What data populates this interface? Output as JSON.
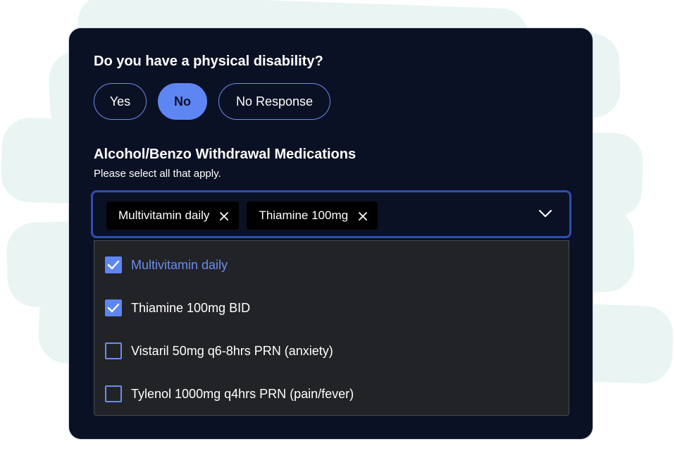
{
  "question": {
    "text": "Do you have a physical disability?",
    "options": [
      {
        "label": "Yes",
        "selected": false
      },
      {
        "label": "No",
        "selected": true
      },
      {
        "label": "No Response",
        "selected": false
      }
    ]
  },
  "medications": {
    "title": "Alcohol/Benzo Withdrawal Medications",
    "subtitle": "Please select all that apply.",
    "selected_chips": [
      {
        "label": "Multivitamin daily"
      },
      {
        "label": "Thiamine 100mg"
      }
    ],
    "dropdown_options": [
      {
        "label": "Multivitamin daily",
        "checked": true
      },
      {
        "label": "Thiamine 100mg BID",
        "checked": true
      },
      {
        "label": "Vistaril 50mg q6-8hrs PRN (anxiety)",
        "checked": false
      },
      {
        "label": "Tylenol 1000mg q4hrs PRN (pain/fever)",
        "checked": false
      }
    ]
  },
  "colors": {
    "card_bg": "#0b1124",
    "accent": "#5e86f3",
    "dropdown_bg": "#222326",
    "chip_bg": "#000000",
    "background_brush": "#eaf5f3"
  },
  "icons": {
    "chip_remove": "close-icon",
    "select_toggle": "chevron-down-icon",
    "checked": "checkmark-icon"
  }
}
